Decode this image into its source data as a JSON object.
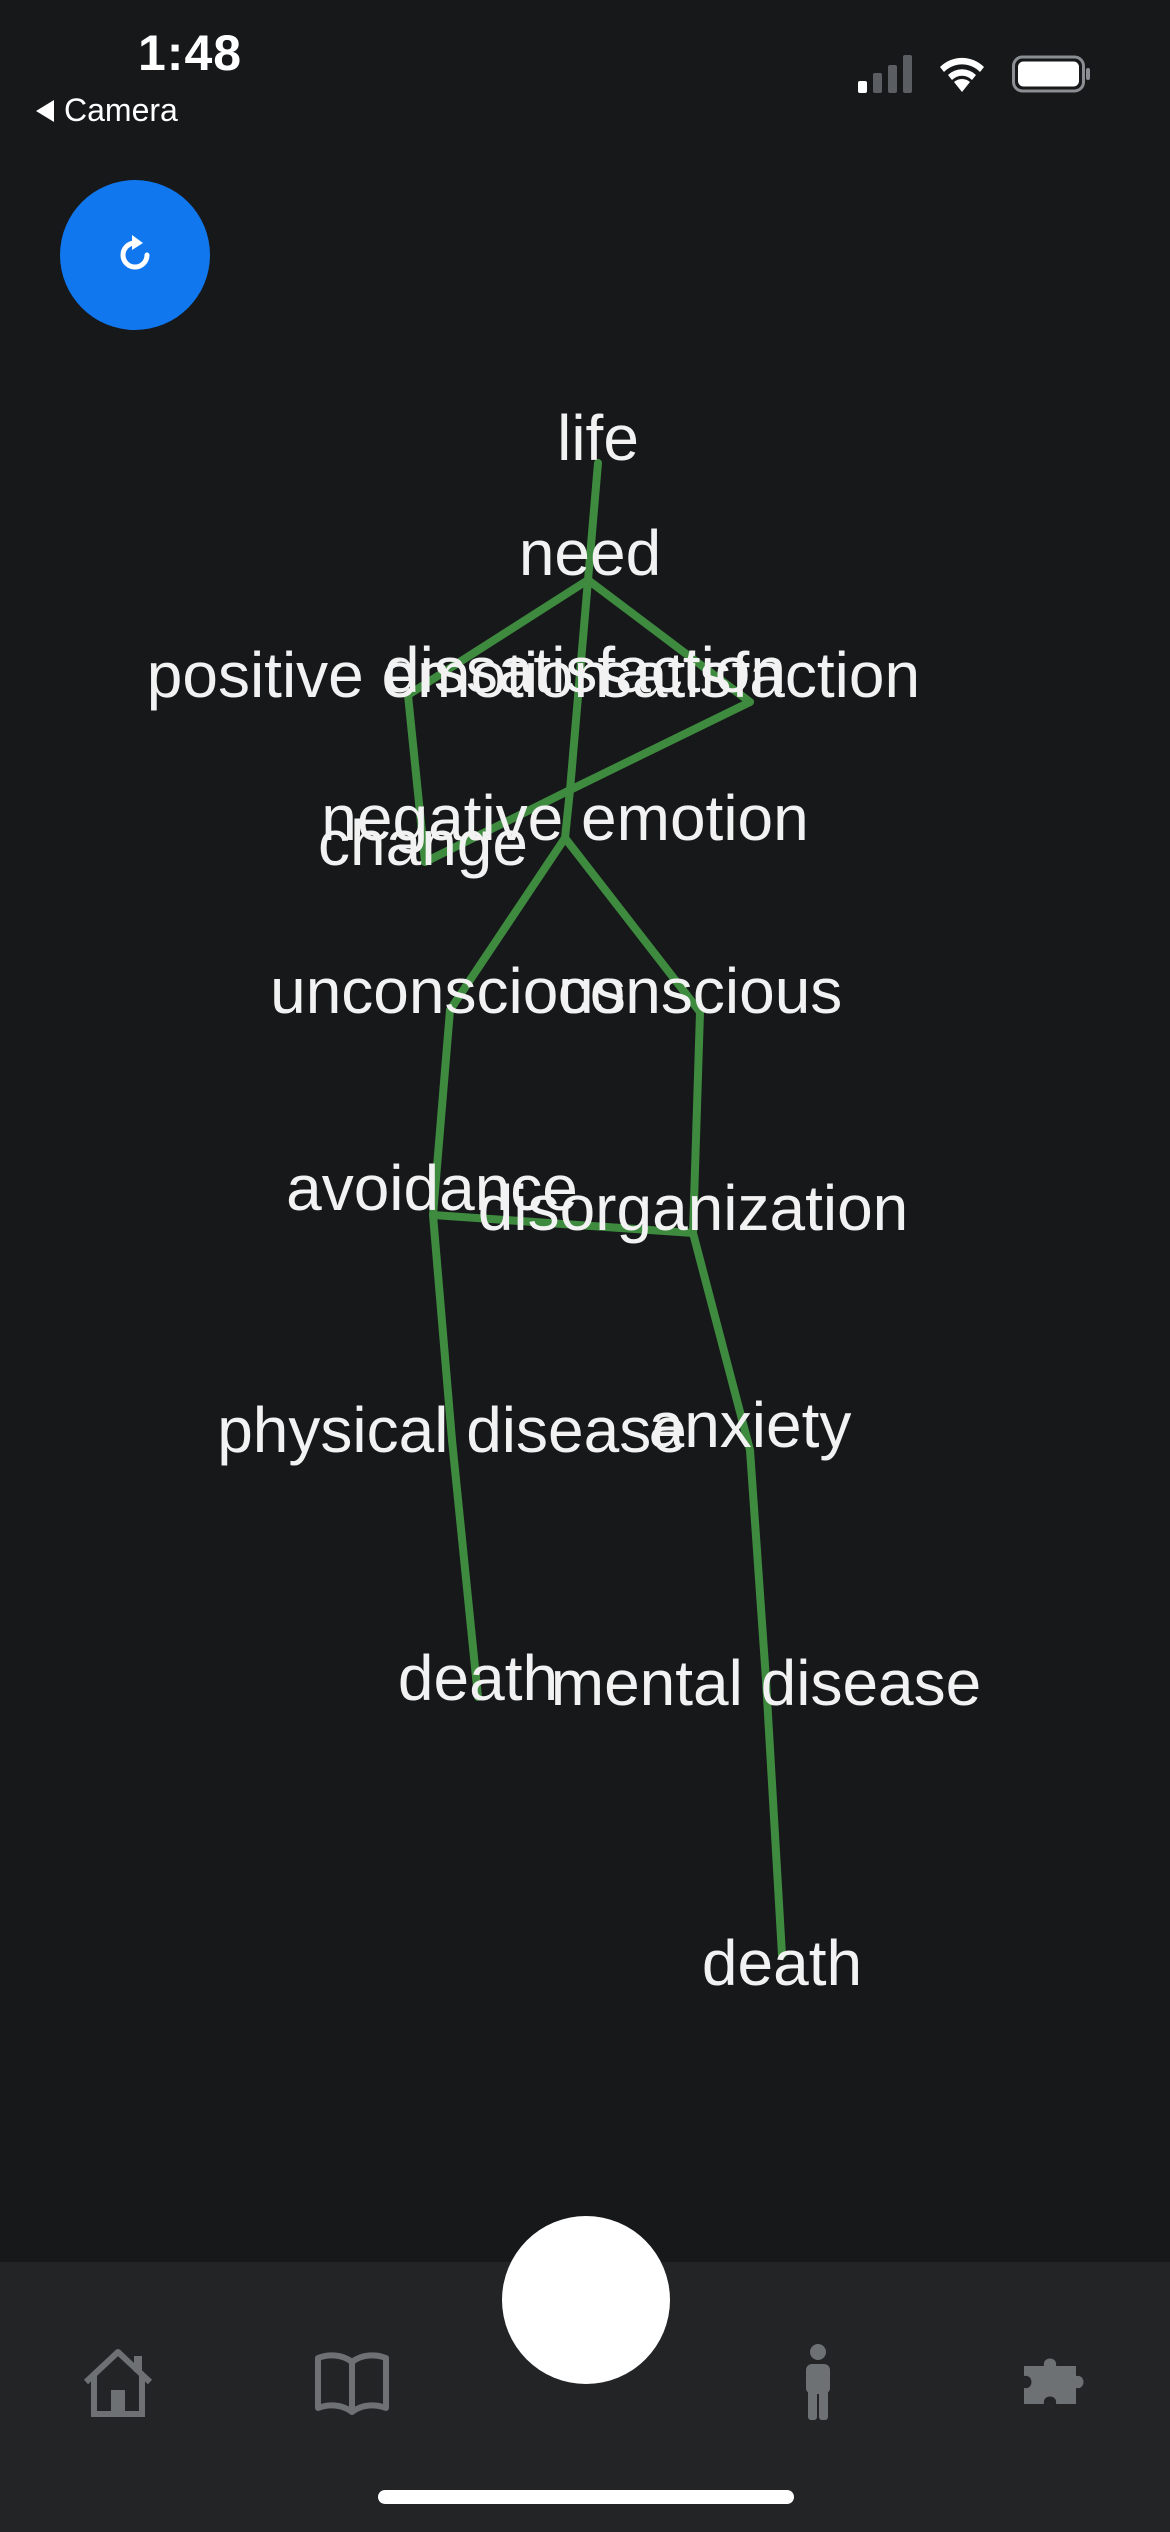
{
  "status_bar": {
    "time": "1:48",
    "back_label": "Camera"
  },
  "refresh_button": {
    "icon": "refresh-icon"
  },
  "skeleton": {
    "line_color": "#3e8a3e",
    "words": [
      {
        "id": "life",
        "text": "life"
      },
      {
        "id": "need",
        "text": "need"
      },
      {
        "id": "positive-emotion",
        "text": "positive emotion"
      },
      {
        "id": "dissatisfaction",
        "text": "dissatisfaction"
      },
      {
        "id": "satisfaction",
        "text": "satisfaction"
      },
      {
        "id": "negative-emotion",
        "text": "negative emotion"
      },
      {
        "id": "change",
        "text": "change"
      },
      {
        "id": "unconscious",
        "text": "unconscious"
      },
      {
        "id": "conscious",
        "text": "conscious"
      },
      {
        "id": "avoidance",
        "text": "avoidance"
      },
      {
        "id": "disorganization",
        "text": "disorganization"
      },
      {
        "id": "physical-disease",
        "text": "physical disease"
      },
      {
        "id": "anxiety",
        "text": "anxiety"
      },
      {
        "id": "death-left",
        "text": "death"
      },
      {
        "id": "mental-disease",
        "text": "mental disease"
      },
      {
        "id": "death-right",
        "text": "death"
      }
    ]
  },
  "tab_bar": {
    "tabs": [
      {
        "id": "home",
        "icon": "home-icon"
      },
      {
        "id": "book",
        "icon": "book-icon"
      },
      {
        "id": "camera",
        "icon": "camera-shutter"
      },
      {
        "id": "person",
        "icon": "person-icon"
      },
      {
        "id": "puzzle",
        "icon": "puzzle-icon"
      }
    ],
    "icon_color": "#6e7174"
  }
}
